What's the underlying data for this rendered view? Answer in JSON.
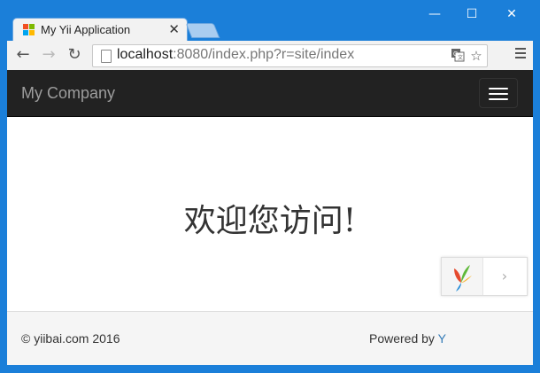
{
  "browser": {
    "tab_title": "My Yii Application",
    "tab_close": "✕",
    "window_controls": {
      "minimize": "—",
      "maximize": "☐",
      "close": "✕"
    },
    "nav": {
      "back": "←",
      "forward": "→",
      "reload": "↻"
    },
    "url_host": "localhost",
    "url_rest": ":8080/index.php?r=site/index",
    "icons": {
      "page": "page-icon",
      "translate": "translate-icon",
      "bookmark": "☆",
      "menu": "menu-icon"
    },
    "colors": {
      "frame": "#1b7fd9",
      "toolbar": "#f2f2f2"
    }
  },
  "page": {
    "navbar": {
      "brand": "My Company",
      "colors": {
        "background": "#222222",
        "brand": "#9d9d9d"
      }
    },
    "main": {
      "heading": "欢迎您访问!"
    },
    "footer": {
      "copyright": "© yiibai.com 2016",
      "powered_prefix": "Powered by ",
      "powered_link": "Y"
    },
    "debug_toolbar": {
      "arrow": "›"
    }
  }
}
